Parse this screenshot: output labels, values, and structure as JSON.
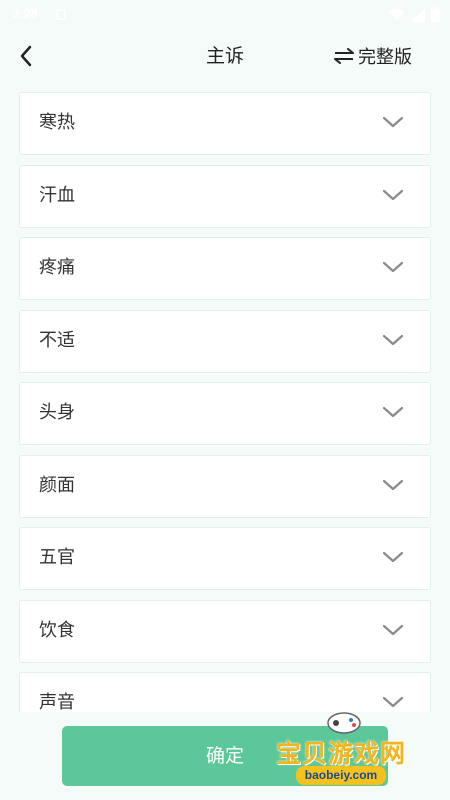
{
  "status_bar": {
    "time": "3:28"
  },
  "header": {
    "title": "主诉",
    "toggle_label": "完整版"
  },
  "items": [
    {
      "label": "寒热"
    },
    {
      "label": "汗血"
    },
    {
      "label": "疼痛"
    },
    {
      "label": "不适"
    },
    {
      "label": "头身"
    },
    {
      "label": "颜面"
    },
    {
      "label": "五官"
    },
    {
      "label": "饮食"
    },
    {
      "label": "声音"
    }
  ],
  "confirm_label": "确定",
  "watermark": {
    "text": "宝贝游戏网",
    "url": "baobeiy.com"
  },
  "colors": {
    "accent": "#5cc799",
    "background": "#f5fbf8",
    "item_border": "#dff2ea",
    "chevron": "#8a8a8a"
  }
}
